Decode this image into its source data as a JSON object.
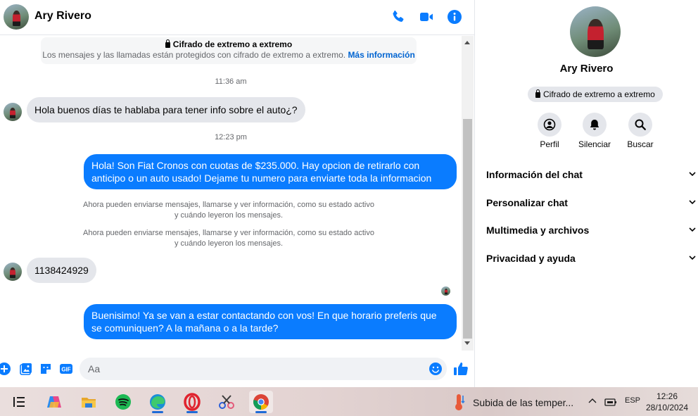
{
  "contact": {
    "name": "Ary Rivero"
  },
  "e2e_notice": {
    "title": "Cifrado de extremo a extremo",
    "description": "Los mensajes y las llamadas están protegidos con cifrado de extremo a extremo.",
    "link": "Más información"
  },
  "messages": [
    {
      "type": "time",
      "text": "11:36 am"
    },
    {
      "type": "incoming",
      "text": "Hola buenos días te hablaba para tener info sobre el auto¿?"
    },
    {
      "type": "time",
      "text": "12:23 pm"
    },
    {
      "type": "outgoing",
      "text": "Hola! Son Fiat Cronos con cuotas de $235.000. Hay opcion de retirarlo con anticipo o un auto usado! Dejame tu numero para enviarte toda la informacion"
    },
    {
      "type": "system",
      "line1": "Ahora pueden enviarse mensajes, llamarse y ver información, como su estado activo",
      "line2": "y cuándo leyeron los mensajes."
    },
    {
      "type": "system",
      "line1": "Ahora pueden enviarse mensajes, llamarse y ver información, como su estado activo",
      "line2": "y cuándo leyeron los mensajes."
    },
    {
      "type": "incoming",
      "text": "1138424929"
    },
    {
      "type": "outgoing",
      "text": "Buenisimo! Ya se van a estar contactando con vos! En que horario preferis que se comuniquen? A la mañana o a la tarde?"
    }
  ],
  "composer": {
    "placeholder": "Aa"
  },
  "info_panel": {
    "name": "Ary Rivero",
    "e2e_badge": "Cifrado de extremo a extremo",
    "actions": {
      "profile": "Perfil",
      "mute": "Silenciar",
      "search": "Buscar"
    },
    "sections": {
      "chat_info": "Información del chat",
      "customize": "Personalizar chat",
      "media": "Multimedia y archivos",
      "privacy": "Privacidad y ayuda"
    }
  },
  "taskbar": {
    "weather": "Subida de las temper...",
    "language": "ESP",
    "time": "12:26",
    "date": "28/10/2024"
  },
  "colors": {
    "accent": "#0a7cff",
    "bubble_in": "#e4e6eb",
    "muted": "#65676b"
  }
}
